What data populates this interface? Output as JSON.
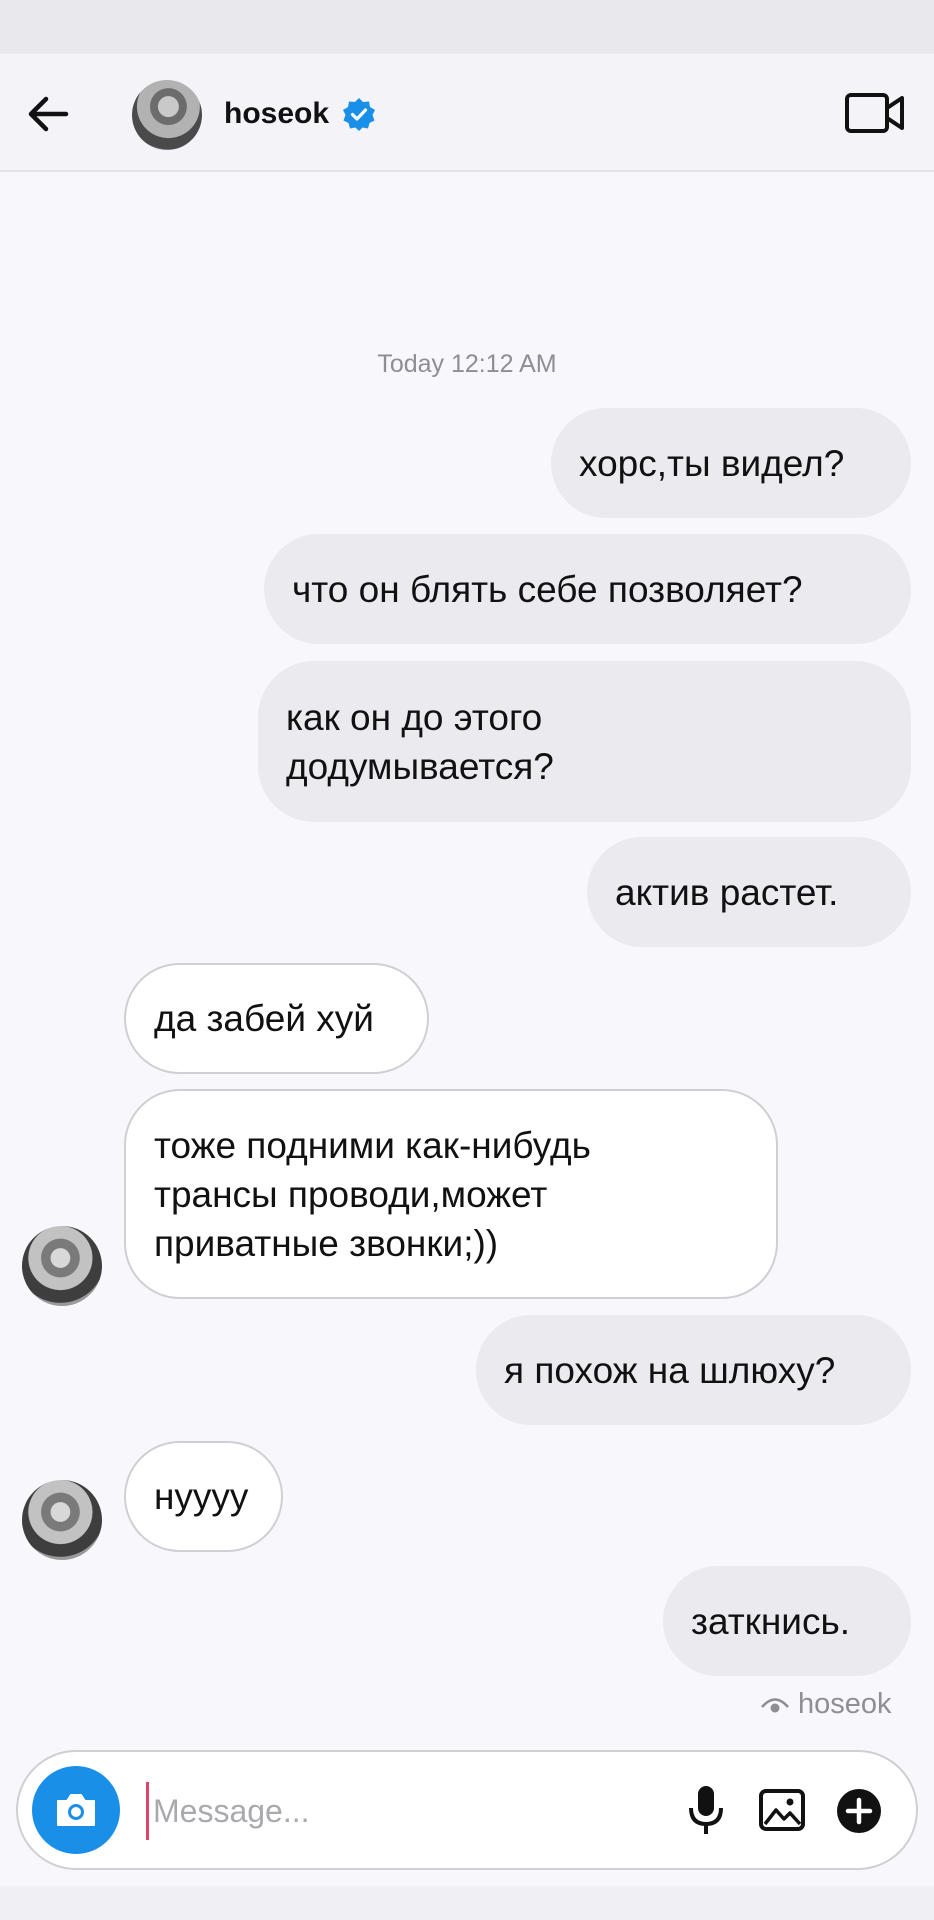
{
  "header": {
    "contact_name": "hoseok",
    "verified_color": "#1a8fe8",
    "back_icon": "arrow-left-icon",
    "video_icon": "video-camera-icon"
  },
  "timestamp": "Today 12:12 AM",
  "messages": [
    {
      "direction": "out",
      "text": "хорс,ты видел?"
    },
    {
      "direction": "out",
      "text": "что он блять себе позволяет?"
    },
    {
      "direction": "out",
      "text": "как он до этого\nдодумывается?"
    },
    {
      "direction": "out",
      "text": "актив растет."
    },
    {
      "direction": "in",
      "text": "да забей хуй"
    },
    {
      "direction": "in",
      "text": "тоже подними как-нибудь\nтрансы проводи,может\nприватные звонки;))"
    },
    {
      "direction": "out",
      "text": "я похож на шлюху?"
    },
    {
      "direction": "in",
      "text": "нуууу"
    },
    {
      "direction": "out",
      "text": "заткнись."
    }
  ],
  "seen": {
    "label": "hoseok",
    "icon": "eye-icon"
  },
  "composer": {
    "placeholder": "Message...",
    "camera_icon": "camera-icon",
    "mic_icon": "microphone-icon",
    "gallery_icon": "image-gallery-icon",
    "plus_icon": "plus-circle-icon",
    "accent": "#1a8fe8"
  }
}
